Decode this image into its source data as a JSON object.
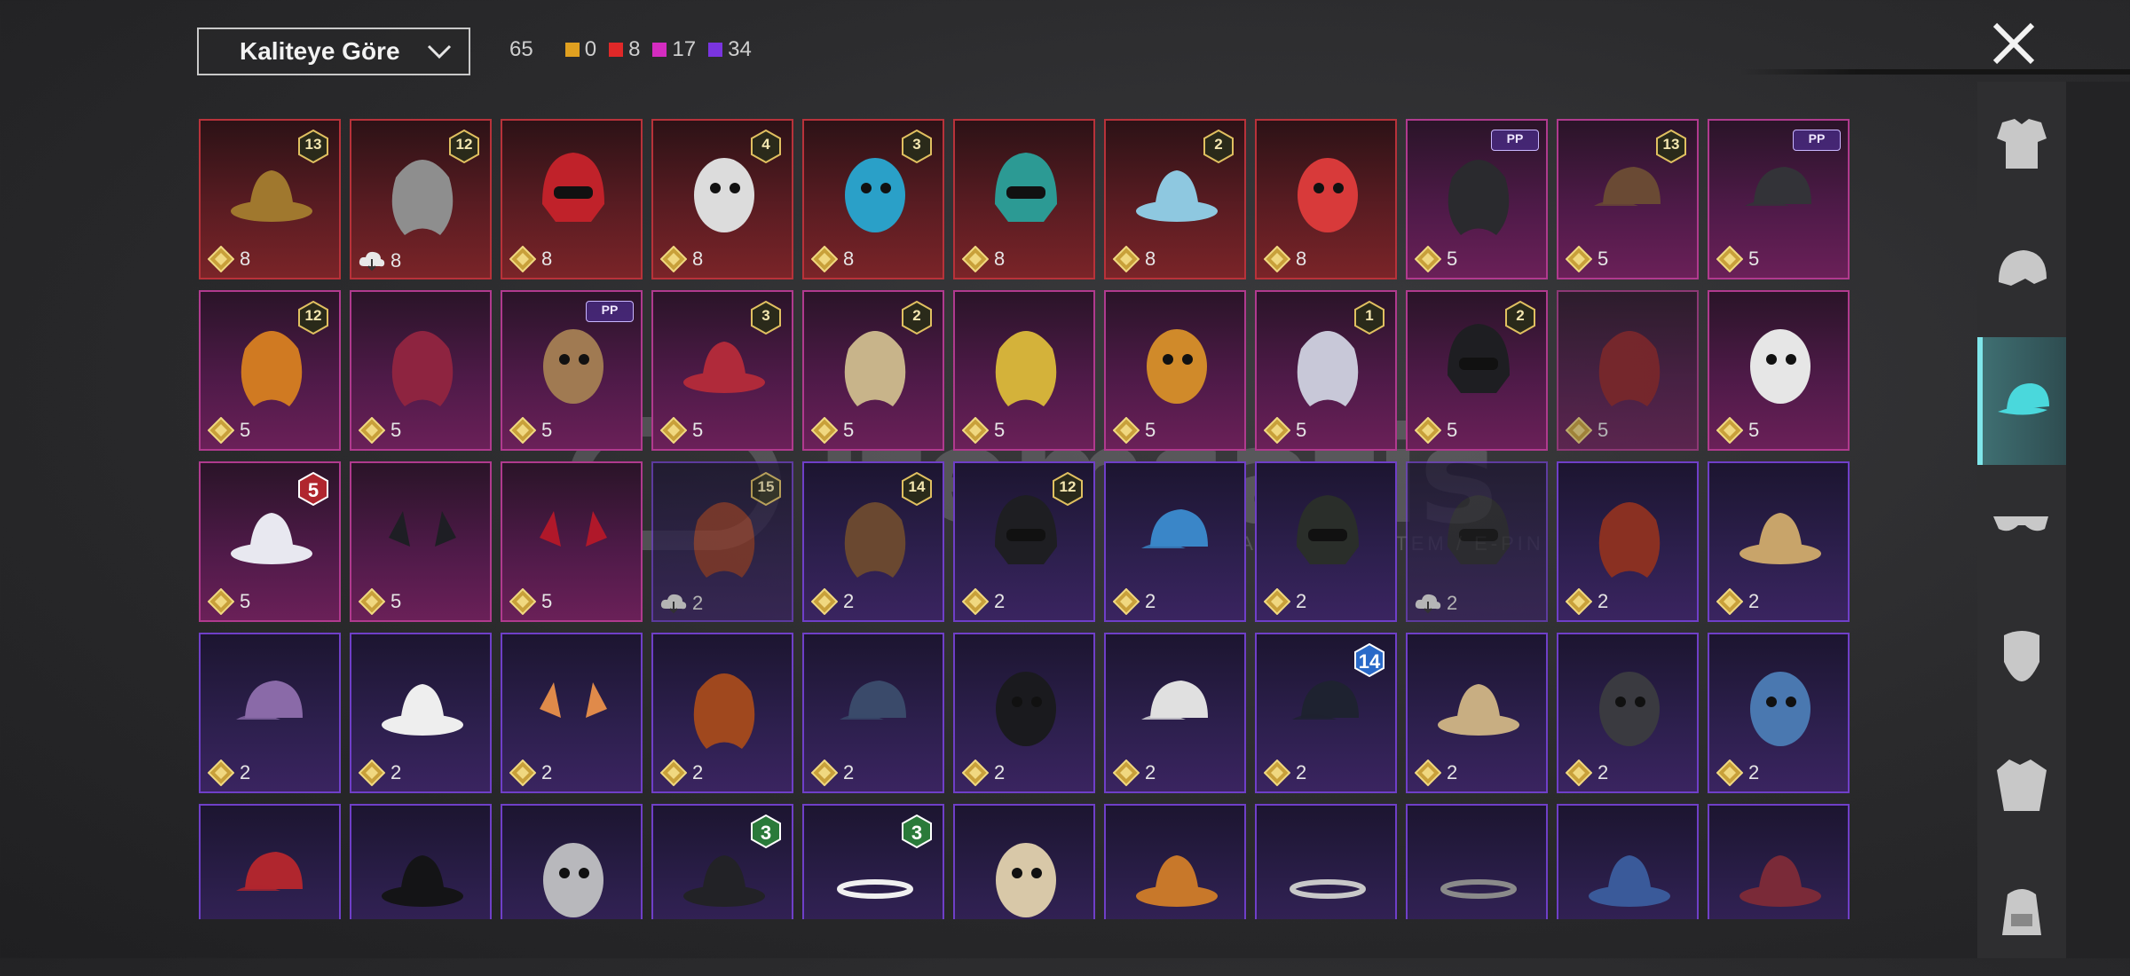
{
  "toolbar": {
    "sort_label": "Kaliteye Göre",
    "total_count": "65",
    "counts": [
      {
        "color": "#e0a020",
        "value": "0"
      },
      {
        "color": "#e02828",
        "value": "8"
      },
      {
        "color": "#d42cc0",
        "value": "17"
      },
      {
        "color": "#7a34e0",
        "value": "34"
      }
    ]
  },
  "watermark": {
    "brand": "itemsatis",
    "tagline": "HESAP / SKIN / ITEM / E-PIN .com"
  },
  "sidebar": {
    "tabs": [
      {
        "name": "outfit-icon"
      },
      {
        "name": "helmet-icon"
      },
      {
        "name": "cap-icon"
      },
      {
        "name": "glasses-icon"
      },
      {
        "name": "mask-icon"
      },
      {
        "name": "jacket-icon"
      },
      {
        "name": "backpack-icon"
      }
    ],
    "active_index": 2
  },
  "items": [
    {
      "tier": "red",
      "badge": "13",
      "cost": "8",
      "art": "hat-hair"
    },
    {
      "tier": "red",
      "badge": "12",
      "cost": "8",
      "art": "grey-hair",
      "cloud": true
    },
    {
      "tier": "red",
      "badge": "",
      "cost": "8",
      "art": "red-helmet"
    },
    {
      "tier": "red",
      "badge": "4",
      "cost": "8",
      "art": "tophat-ball"
    },
    {
      "tier": "red",
      "badge": "3",
      "cost": "8",
      "art": "clown-head"
    },
    {
      "tier": "red",
      "badge": "",
      "cost": "8",
      "art": "teal-helmet"
    },
    {
      "tier": "red",
      "badge": "2",
      "cost": "8",
      "art": "bucket-hat"
    },
    {
      "tier": "red",
      "badge": "",
      "cost": "8",
      "art": "demon-mask"
    },
    {
      "tier": "pink",
      "badge": "PP",
      "cost": "5",
      "art": "dark-hair"
    },
    {
      "tier": "pink",
      "badge": "13",
      "cost": "5",
      "art": "goggles-cap"
    },
    {
      "tier": "pink",
      "badge": "PP",
      "cost": "5",
      "art": "cap-goggles"
    },
    {
      "tier": "pink",
      "badge": "12",
      "cost": "5",
      "art": "orange-hair"
    },
    {
      "tier": "pink",
      "badge": "",
      "cost": "5",
      "art": "crimson-hair"
    },
    {
      "tier": "pink",
      "badge": "PP",
      "cost": "5",
      "art": "bull-head"
    },
    {
      "tier": "pink",
      "badge": "3",
      "cost": "5",
      "art": "jester-hat"
    },
    {
      "tier": "pink",
      "badge": "2",
      "cost": "5",
      "art": "sailor-hair"
    },
    {
      "tier": "pink",
      "badge": "",
      "cost": "5",
      "art": "feather-headdress"
    },
    {
      "tier": "pink",
      "badge": "",
      "cost": "5",
      "art": "potato-head"
    },
    {
      "tier": "pink",
      "badge": "1",
      "cost": "5",
      "art": "silver-hair"
    },
    {
      "tier": "pink",
      "badge": "2",
      "cost": "5",
      "art": "black-mask"
    },
    {
      "tier": "pink",
      "badge": "",
      "cost": "5",
      "art": "red-braid",
      "dim": true
    },
    {
      "tier": "pink",
      "badge": "",
      "cost": "5",
      "art": "zebra-head"
    },
    {
      "tier": "pink",
      "badge": "5",
      "badge_style": "red",
      "cost": "5",
      "art": "white-hat"
    },
    {
      "tier": "pink",
      "badge": "",
      "cost": "5",
      "art": "dark-ears"
    },
    {
      "tier": "pink",
      "badge": "",
      "cost": "5",
      "art": "red-horns"
    },
    {
      "tier": "purple",
      "badge": "15",
      "cost": "2",
      "art": "witch-hair",
      "cloud": true,
      "dim": true
    },
    {
      "tier": "purple",
      "badge": "14",
      "cost": "2",
      "art": "brown-hair"
    },
    {
      "tier": "purple",
      "badge": "12",
      "cost": "2",
      "art": "bunny-helmet"
    },
    {
      "tier": "purple",
      "badge": "",
      "cost": "2",
      "art": "blue-cap"
    },
    {
      "tier": "purple",
      "badge": "",
      "cost": "2",
      "art": "gas-helmet"
    },
    {
      "tier": "purple",
      "badge": "",
      "cost": "2",
      "art": "dark-helmet",
      "cloud": true,
      "dim": true
    },
    {
      "tier": "purple",
      "badge": "",
      "cost": "2",
      "art": "goggle-hair"
    },
    {
      "tier": "purple",
      "badge": "",
      "cost": "2",
      "art": "bunny-hat"
    },
    {
      "tier": "purple",
      "badge": "",
      "cost": "2",
      "art": "dotted-cap"
    },
    {
      "tier": "purple",
      "badge": "",
      "cost": "2",
      "art": "sun-hat"
    },
    {
      "tier": "purple",
      "badge": "",
      "cost": "2",
      "art": "fox-ears"
    },
    {
      "tier": "purple",
      "badge": "",
      "cost": "2",
      "art": "samurai-hair"
    },
    {
      "tier": "purple",
      "badge": "",
      "cost": "2",
      "art": "navy-cap"
    },
    {
      "tier": "purple",
      "badge": "",
      "cost": "2",
      "art": "gas-mask"
    },
    {
      "tier": "purple",
      "badge": "",
      "cost": "2",
      "art": "officer-cap"
    },
    {
      "tier": "purple",
      "badge": "14",
      "badge_style": "blue",
      "cost": "2",
      "art": "police-cap"
    },
    {
      "tier": "purple",
      "badge": "",
      "cost": "2",
      "art": "straw-hat"
    },
    {
      "tier": "purple",
      "badge": "",
      "cost": "2",
      "art": "wrestler-mask"
    },
    {
      "tier": "purple",
      "badge": "",
      "cost": "2",
      "art": "shark-hat"
    },
    {
      "tier": "purple",
      "badge": "",
      "cost": "",
      "art": "red-beret"
    },
    {
      "tier": "purple",
      "badge": "",
      "cost": "",
      "art": "bowler-hat"
    },
    {
      "tier": "purple",
      "badge": "",
      "cost": "",
      "art": "shark-head"
    },
    {
      "tier": "purple",
      "badge": "3",
      "badge_style": "green",
      "cost": "",
      "art": "fedora"
    },
    {
      "tier": "purple",
      "badge": "3",
      "badge_style": "green",
      "cost": "",
      "art": "flower-crown"
    },
    {
      "tier": "purple",
      "badge": "",
      "cost": "",
      "art": "cake-hat"
    },
    {
      "tier": "purple",
      "badge": "",
      "cost": "",
      "art": "burger-hat"
    },
    {
      "tier": "purple",
      "badge": "",
      "cost": "",
      "art": "head-mirror"
    },
    {
      "tier": "purple",
      "badge": "",
      "cost": "",
      "art": "headband"
    },
    {
      "tier": "purple",
      "badge": "",
      "cost": "",
      "art": "blue-fez"
    },
    {
      "tier": "purple",
      "badge": "",
      "cost": "",
      "art": "maroon-fedora"
    }
  ]
}
